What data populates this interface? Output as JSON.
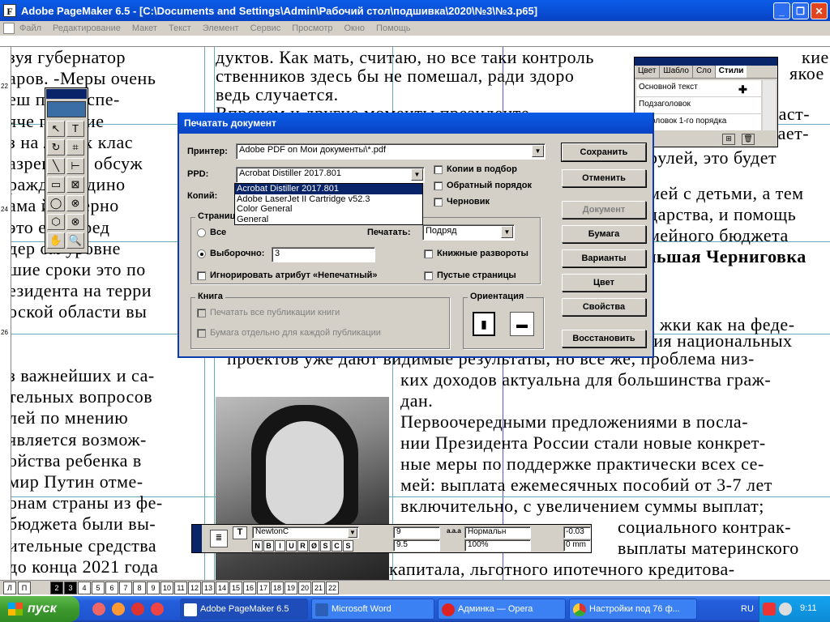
{
  "window": {
    "title": "Adobe PageMaker 6.5 - [C:\\Documents and Settings\\Admin\\Рабочий стол\\подшивка\\2020\\№3\\№3.p65]",
    "app_icon_letter": "F"
  },
  "menu": [
    "Файл",
    "Редактирование",
    "Макет",
    "Текст",
    "Элемент",
    "Сервис",
    "Просмотр",
    "Окно",
    "Помощь"
  ],
  "ruler_left_marks": [
    "22",
    "24",
    "26"
  ],
  "document_text": {
    "left_column": [
      "зуя губернатор",
      "аров. -Меры очень",
      "еш    по обеспе-",
      "яче  питание",
      "з на  льных клас",
      "азреш  Мы обсуж",
      "ражд й \"Едино",
      "ама  й губерно",
      "это   его, пред",
      "дер  ом уровне",
      "шие сроки это по",
      "езидента на терри",
      "оской области вы",
      "",
      "",
      "з важнейших и са-",
      "тельных вопросов",
      "лей по мнению",
      "является возмож-",
      "ойства ребенка в",
      "мир Путин отме-",
      "онам страны из фе-",
      "бюджета были вы-",
      "ительные средства",
      "до конца 2021 года"
    ],
    "mid_top": [
      "дуктов. Как мать, считаю, но все таки контроль",
      "ственников здесь бы не помешал, ради здоро",
      "ведь случается.",
      "      Впрочем и другие моменты президенте"
    ],
    "right_top": [
      "кие",
      "якое",
      "част-",
      "вает-",
      "рулей, это будет",
      "мей с детьми, а тем",
      "дарства, и помощь",
      "мейного бюджета",
      "ольшая Черниговка",
      "жки как на феде-",
      "ция национальных",
      "проектов уже дают видимые результаты, но все же, проблема низ-"
    ],
    "right_bottom": [
      "ких доходов актуальна для большинства граж-",
      "дан.",
      "      Первоочередными предложениями в посла-",
      "нии Президента России стали новые конкрет-",
      "ные меры по  поддержке практически всех се-",
      "мей: выплата ежемесячных пособий от 3-7 лет",
      "включительно, с увеличением суммы выплат;",
      "социального контрак-",
      "выплаты материнского",
      "капитала, льготного ипотечного кредитова-"
    ]
  },
  "tools": [
    {
      "icon": "arrow-tool-icon",
      "glyph": "↖"
    },
    {
      "icon": "text-tool-icon",
      "glyph": "T"
    },
    {
      "icon": "rotate-tool-icon",
      "glyph": "↻"
    },
    {
      "icon": "crop-tool-icon",
      "glyph": "⌗"
    },
    {
      "icon": "line-tool-icon",
      "glyph": "╲"
    },
    {
      "icon": "constrained-line-tool-icon",
      "glyph": "⊢"
    },
    {
      "icon": "rectangle-tool-icon",
      "glyph": "▭"
    },
    {
      "icon": "rectangle-frame-tool-icon",
      "glyph": "⊠"
    },
    {
      "icon": "ellipse-tool-icon",
      "glyph": "◯"
    },
    {
      "icon": "ellipse-frame-tool-icon",
      "glyph": "⊗"
    },
    {
      "icon": "polygon-tool-icon",
      "glyph": "⬡"
    },
    {
      "icon": "polygon-frame-tool-icon",
      "glyph": "⊗"
    },
    {
      "icon": "hand-tool-icon",
      "glyph": "✋"
    },
    {
      "icon": "zoom-tool-icon",
      "glyph": "🔍"
    }
  ],
  "styles_palette": {
    "tabs": [
      "Цвет",
      "Шабло",
      "Сло",
      "Стили"
    ],
    "items": [
      "Основной текст",
      "Подзаголовок",
      "Заголовок 1-го порядка"
    ]
  },
  "dialog": {
    "title": "Печатать документ",
    "printer_label": "Принтер:",
    "printer_value": "Adobe PDF on Мои документы\\*.pdf",
    "ppd_label": "PPD:",
    "ppd_value": "Acrobat Distiller 2017.801",
    "ppd_options": [
      "Acrobat Distiller 2017.801",
      "Adobe LaserJet II Cartridge v52.3",
      "Color General",
      "General"
    ],
    "copies_label": "Копий:",
    "collate_label": "Копии в подбор",
    "reverse_label": "Обратный порядок",
    "proof_label": "Черновик",
    "pages_group": "Страницы",
    "all_label": "Все",
    "range_label": "Выборочно:",
    "range_value": "3",
    "print_label": "Печатать:",
    "print_value": "Подряд",
    "ignore_label": "Игнорировать атрибут «Непечатный»",
    "spreads_label": "Книжные развороты",
    "blank_label": "Пустые страницы",
    "book_group": "Книга",
    "book_all_label": "Печатать все публикации книги",
    "book_paper_label": "Бумага отдельно для каждой публикации",
    "orientation_group": "Ориентация",
    "buttons": {
      "save": "Сохранить",
      "cancel": "Отменить",
      "document": "Документ",
      "paper": "Бумага",
      "options": "Варианты",
      "color": "Цвет",
      "properties": "Свойства",
      "reset": "Восстановить"
    }
  },
  "control_palette": {
    "font": "NewtonC",
    "style_buttons": [
      "N",
      "B",
      "I",
      "U",
      "R",
      "Ø",
      "S",
      "C",
      "S"
    ],
    "size": "9",
    "leading": "9.5",
    "width": "Нормальн",
    "tracking": "100%",
    "kern": "-0.03",
    "baseline": "0 mm",
    "t_label": "T",
    "tracking_glyph": "a.a.a"
  },
  "page_tabs": {
    "letters": [
      "Л",
      "П"
    ],
    "numbers": [
      "2",
      "3",
      "4",
      "5",
      "6",
      "7",
      "8",
      "9",
      "10",
      "11",
      "12",
      "13",
      "14",
      "15",
      "16",
      "17",
      "18",
      "19",
      "20",
      "21",
      "22"
    ],
    "selected": [
      "2",
      "3"
    ]
  },
  "taskbar": {
    "start": "пуск",
    "tasks": [
      "Adobe PageMaker 6.5",
      "Microsoft Word",
      "Админка — Opera",
      "Настройки под 76 ф..."
    ],
    "lang": "RU",
    "time": "9:11"
  }
}
